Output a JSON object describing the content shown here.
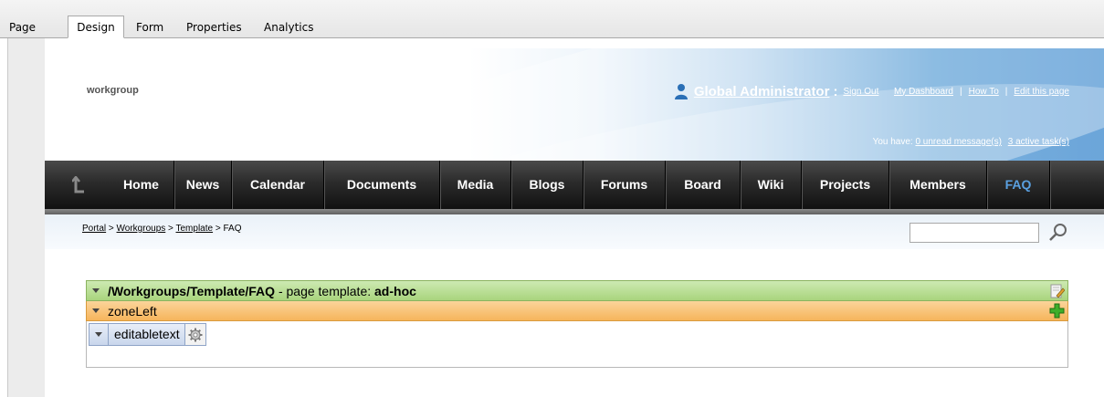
{
  "tabs": [
    {
      "label": "Page",
      "active": false
    },
    {
      "label": "Design",
      "active": true
    },
    {
      "label": "Form",
      "active": false
    },
    {
      "label": "Properties",
      "active": false
    },
    {
      "label": "Analytics",
      "active": false
    }
  ],
  "header": {
    "site_name": "workgroup",
    "user_name": "Global Administrator",
    "user_suffix": ":",
    "links": {
      "sign_out": "Sign Out",
      "dashboard": "My Dashboard",
      "how_to": "How To",
      "edit_page": "Edit this page",
      "separator": "|"
    },
    "tasks_prefix": "You have:",
    "unread_messages": "0 unread message(s)",
    "active_tasks": "3 active task(s)"
  },
  "nav": {
    "items": [
      "Home",
      "News",
      "Calendar",
      "Documents",
      "Media",
      "Blogs",
      "Forums",
      "Board",
      "Wiki",
      "Projects",
      "Members",
      "FAQ"
    ],
    "active": "FAQ"
  },
  "breadcrumb": {
    "items": [
      "Portal",
      "Workgroups",
      "Template",
      "FAQ"
    ],
    "separator": ">"
  },
  "search": {
    "value": ""
  },
  "design": {
    "template_path": "/Workgroups/Template/FAQ",
    "template_label": " - page template: ",
    "template_type": "ad-hoc",
    "zone_name": "zoneLeft",
    "webpart_name": "editabletext"
  },
  "colors": {
    "nav_active": "#5aa0e0",
    "template_bar": "#b8dd93",
    "zone_bar": "#f8c47a",
    "header_blue": "#3a87cd"
  }
}
